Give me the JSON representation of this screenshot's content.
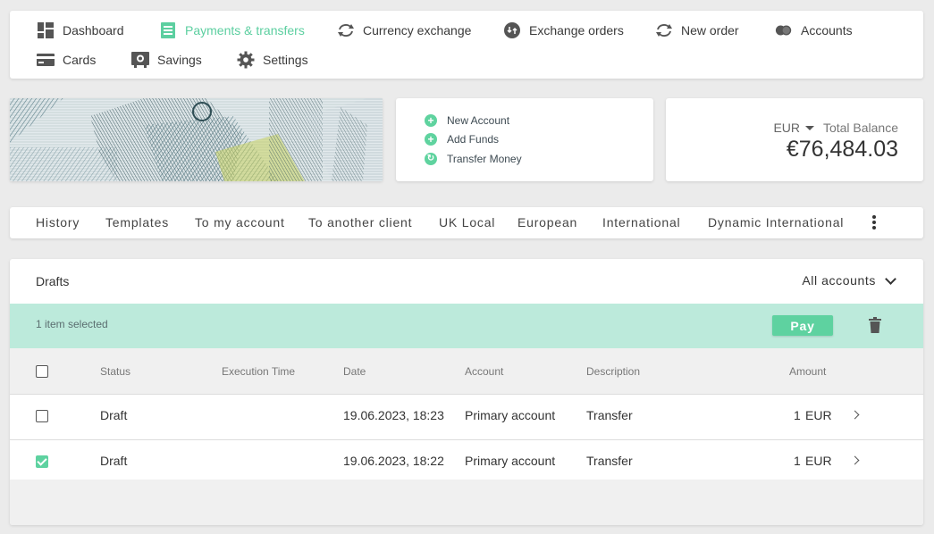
{
  "nav": {
    "items": [
      {
        "label": "Dashboard",
        "icon": "dashboard-icon"
      },
      {
        "label": "Payments & transfers",
        "icon": "payments-icon",
        "active": true
      },
      {
        "label": "Currency exchange",
        "icon": "exchange-icon"
      },
      {
        "label": "Exchange orders",
        "icon": "exchange-orders-icon"
      },
      {
        "label": "New order",
        "icon": "new-order-icon"
      },
      {
        "label": "Accounts",
        "icon": "accounts-icon"
      },
      {
        "label": "Cards",
        "icon": "cards-icon"
      },
      {
        "label": "Savings",
        "icon": "savings-icon"
      },
      {
        "label": "Settings",
        "icon": "gear-icon"
      }
    ]
  },
  "quick_actions": [
    {
      "label": "New Account",
      "icon": "plus-circle-icon"
    },
    {
      "label": "Add Funds",
      "icon": "plus-circle-icon"
    },
    {
      "label": "Transfer Money",
      "icon": "refresh-circle-icon"
    }
  ],
  "balance": {
    "currency": "EUR",
    "label": "Total Balance",
    "value": "€76,484.03"
  },
  "tabs": [
    "History",
    "Templates",
    "To my account",
    "To another client",
    "UK Local",
    "European",
    "International",
    "Dynamic International"
  ],
  "drafts": {
    "title": "Drafts",
    "account_filter": "All accounts",
    "selection_text": "1 item selected",
    "pay_label": "Pay",
    "columns": [
      "Status",
      "Execution Time",
      "Date",
      "Account",
      "Description",
      "Amount"
    ],
    "rows": [
      {
        "checked": false,
        "status": "Draft",
        "execution_time": "",
        "date": "19.06.2023, 18:23",
        "account": "Primary account",
        "description": "Transfer",
        "amount": "1",
        "currency": "EUR"
      },
      {
        "checked": true,
        "status": "Draft",
        "execution_time": "",
        "date": "19.06.2023, 18:22",
        "account": "Primary account",
        "description": "Transfer",
        "amount": "1",
        "currency": "EUR"
      }
    ]
  },
  "colors": {
    "accent": "#5ed2a0",
    "selection_bar": "#bceadb",
    "background": "#ebebeb"
  }
}
